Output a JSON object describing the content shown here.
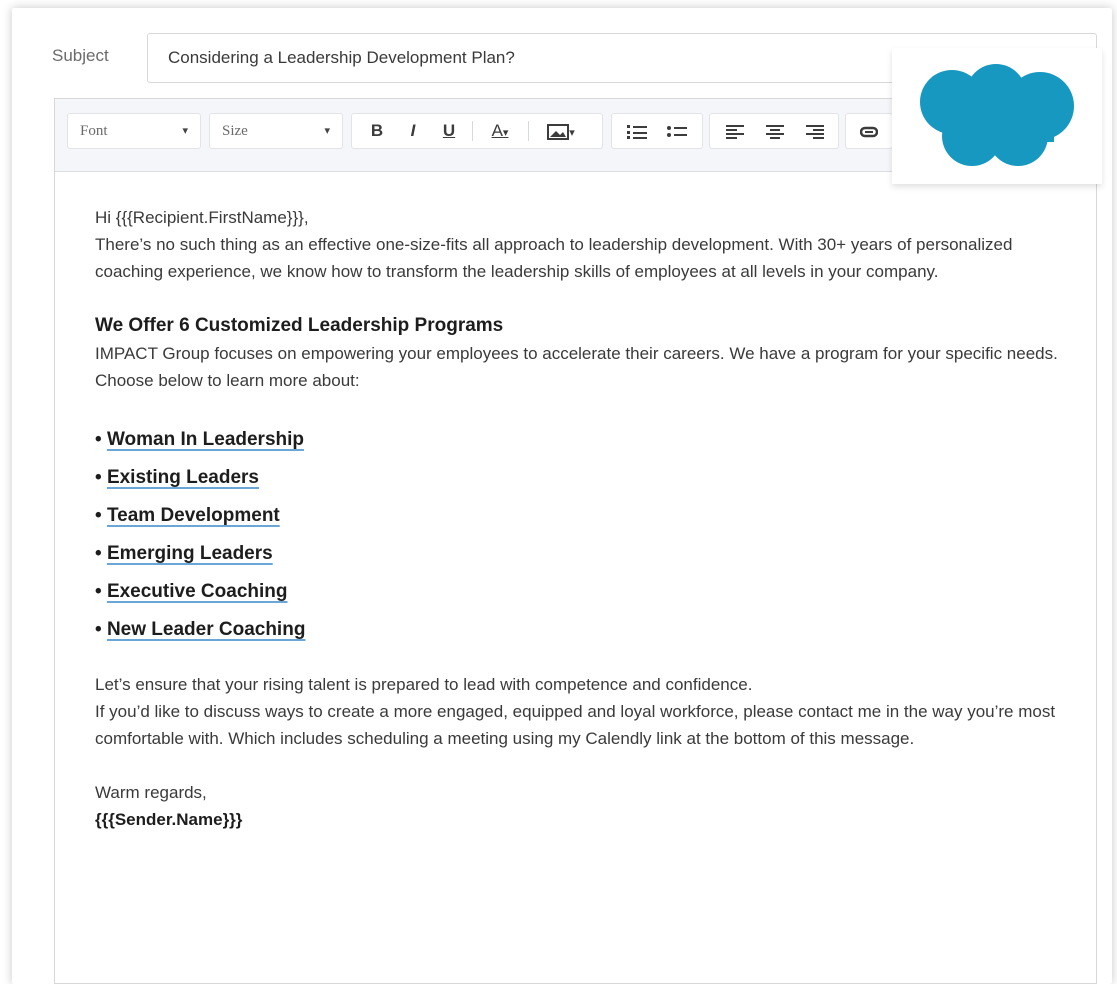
{
  "subject": {
    "label": "Subject",
    "value": "Considering a Leadership Development Plan?"
  },
  "toolbar": {
    "font_label": "Font",
    "size_label": "Size",
    "bold": "B",
    "italic": "I",
    "underline": "U",
    "text_color": "A",
    "caret": "▾",
    "icons": [
      "bold-icon",
      "italic-icon",
      "underline-icon",
      "text-color-icon",
      "image-icon",
      "numbered-list-icon",
      "bulleted-list-icon",
      "align-left-icon",
      "align-center-icon",
      "align-right-icon",
      "link-icon"
    ]
  },
  "logo": {
    "name": "salesforce-cloud-logo",
    "color": "#1798c1"
  },
  "email": {
    "greeting": "Hi {{{Recipient.FirstName}}},",
    "intro": "There’s no such thing as an effective one-size-fits all approach to leadership development. With 30+ years of personalized coaching experience, we know how to transform the leadership skills of employees at all levels in your company.",
    "heading": "We Offer 6 Customized Leadership Programs",
    "program_intro": "IMPACT Group focuses on empowering your employees to accelerate their careers. We have a program for your specific needs. Choose below to learn more about:",
    "programs": [
      "Woman In Leadership",
      "Existing Leaders",
      "Team Development",
      "Emerging Leaders",
      "Executive Coaching",
      "New Leader Coaching"
    ],
    "closing_1": "Let’s ensure that your rising talent is prepared to lead with competence and confidence.",
    "closing_2": "If you’d like to discuss ways to create a more engaged, equipped and loyal workforce, please contact me in the way you’re most comfortable with. Which includes scheduling a meeting using my Calendly link at the bottom of this message.",
    "signoff": "Warm regards,",
    "sender": "{{{Sender.Name}}}"
  },
  "colors": {
    "link_underline": "#6aa6d6",
    "toolbar_bg": "#f4f6f9",
    "logo_blue": "#1798c1"
  }
}
